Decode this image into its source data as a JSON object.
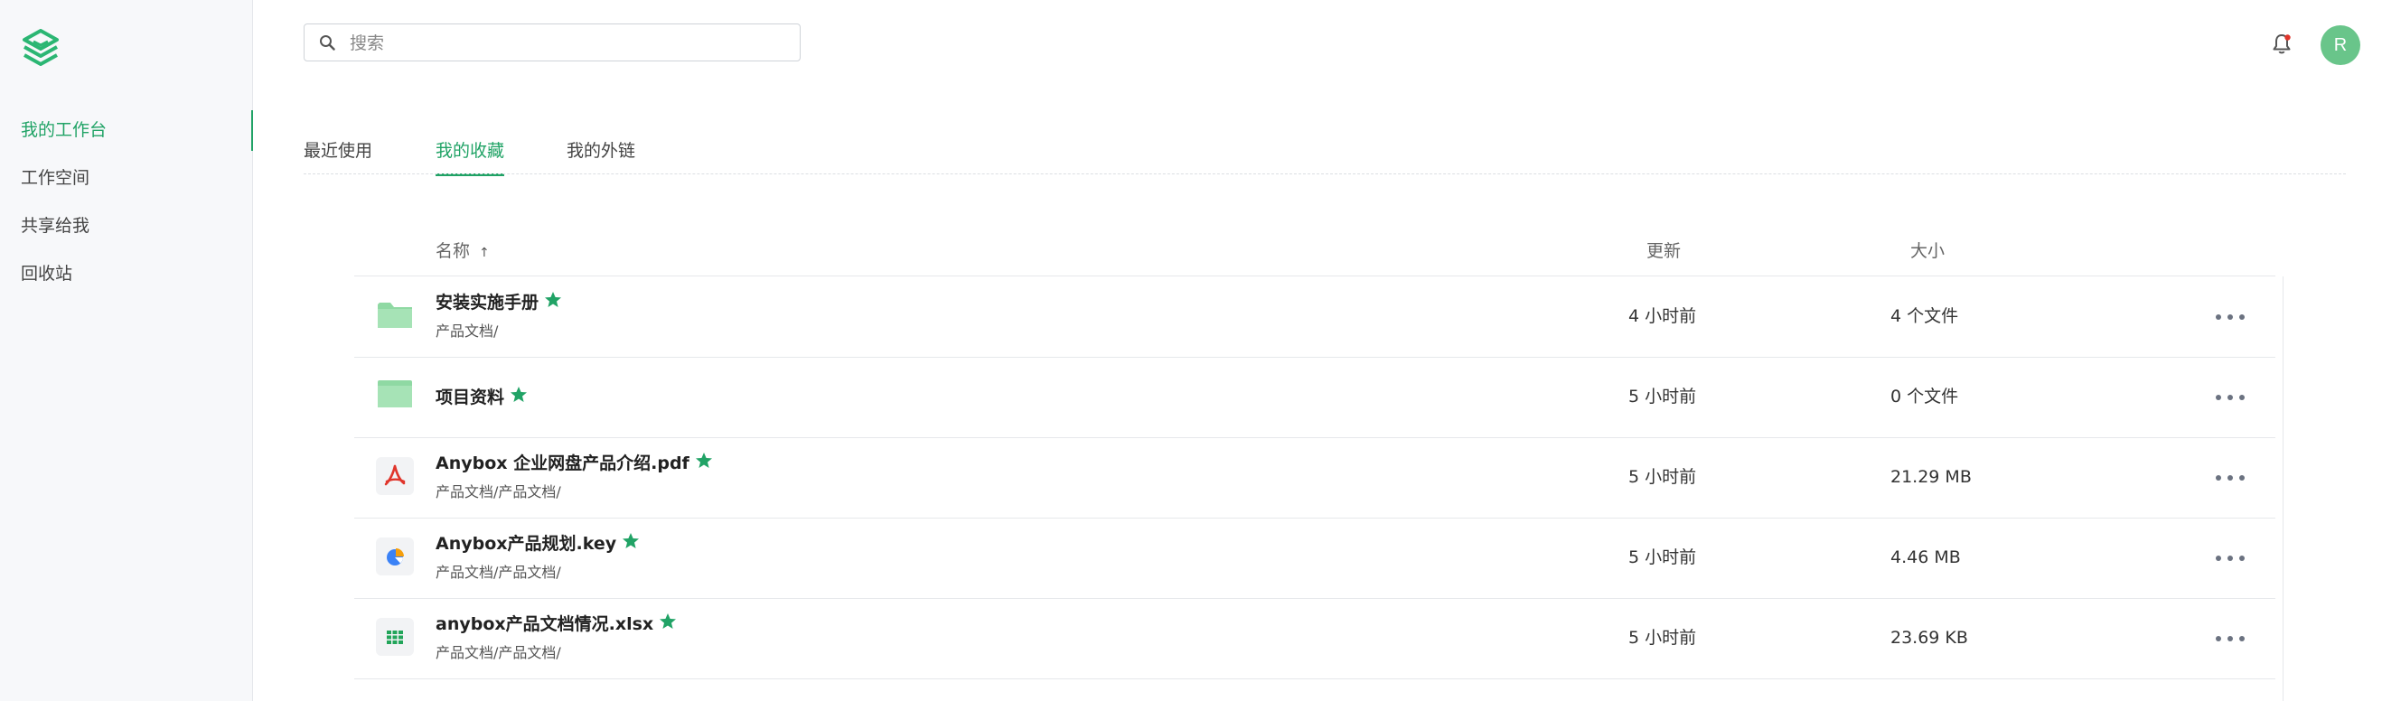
{
  "sidebar": {
    "items": [
      {
        "label": "我的工作台",
        "active": true
      },
      {
        "label": "工作空间",
        "active": false
      },
      {
        "label": "共享给我",
        "active": false
      },
      {
        "label": "回收站",
        "active": false
      }
    ]
  },
  "header": {
    "search_placeholder": "搜索",
    "avatar_initial": "R"
  },
  "tabs": [
    {
      "label": "最近使用",
      "active": false
    },
    {
      "label": "我的收藏",
      "active": true
    },
    {
      "label": "我的外链",
      "active": false
    }
  ],
  "table": {
    "columns": {
      "name": "名称",
      "updated": "更新",
      "size": "大小"
    },
    "sort_indicator": "↑",
    "rows": [
      {
        "name": "安装实施手册",
        "path": "产品文档/",
        "updated": "4 小时前",
        "size": "4 个文件",
        "icon": "folder-icon",
        "starred": true
      },
      {
        "name": "项目资料",
        "path": "",
        "updated": "5 小时前",
        "size": "0 个文件",
        "icon": "folder-icon",
        "starred": true
      },
      {
        "name": "Anybox 企业网盘产品介绍.pdf",
        "path": "产品文档/产品文档/",
        "updated": "5 小时前",
        "size": "21.29 MB",
        "icon": "pdf-icon",
        "starred": true
      },
      {
        "name": "Anybox产品规划.key",
        "path": "产品文档/产品文档/",
        "updated": "5 小时前",
        "size": "4.46 MB",
        "icon": "keynote-icon",
        "starred": true
      },
      {
        "name": "anybox产品文档情况.xlsx",
        "path": "产品文档/产品文档/",
        "updated": "5 小时前",
        "size": "23.69 KB",
        "icon": "spreadsheet-icon",
        "starred": true
      }
    ]
  },
  "colors": {
    "accent": "#21a366",
    "star": "#21a366",
    "folder": "#8fd9a3",
    "avatar_bg": "#69c58a",
    "pdf": "#e0352b"
  }
}
